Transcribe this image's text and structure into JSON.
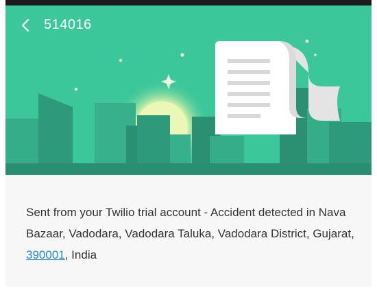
{
  "header": {
    "title": "514016",
    "back_icon": "chevron-left-icon",
    "background_color": "#3bc79a"
  },
  "message": {
    "text_before_link": "Sent from your Twilio trial account - Accident detected in Nava Bazaar, Vadodara, Vadodara Taluka, Vadodara District, Gujarat, ",
    "link_text": "390001",
    "text_after_link": ", India",
    "link_color": "#1e88e5"
  }
}
